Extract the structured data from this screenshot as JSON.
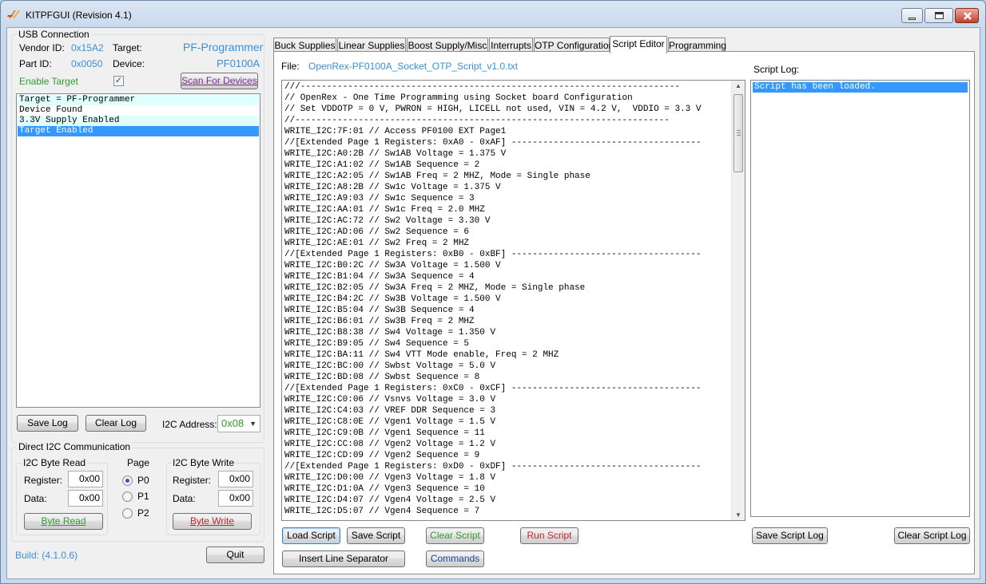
{
  "window": {
    "title": "KITPFGUI (Revision 4.1)"
  },
  "usb": {
    "group_title": "USB Connection",
    "vendor_label": "Vendor ID:",
    "vendor_value": "0x15A2",
    "target_label": "Target:",
    "target_value": "PF-Programmer",
    "part_label": "Part ID:",
    "part_value": "0x0050",
    "device_label": "Device:",
    "device_value": "PF0100A",
    "enable_target_label": "Enable Target",
    "enable_target_checked": true,
    "scan_button": "Scan For Devices"
  },
  "status_list": [
    "Target = PF-Programmer",
    "Device Found",
    "3.3V Supply Enabled",
    "Target Enabled"
  ],
  "log_buttons": {
    "save_log": "Save Log",
    "clear_log": "Clear Log"
  },
  "i2c_address": {
    "label": "I2C Address:",
    "value": "0x08"
  },
  "direct_i2c": {
    "group_title": "Direct I2C Communication",
    "read": {
      "title": "I2C Byte Read",
      "register_label": "Register:",
      "register_value": "0x00",
      "data_label": "Data:",
      "data_value": "0x00",
      "button": "Byte Read"
    },
    "page": {
      "title": "Page",
      "options": [
        "P0",
        "P1",
        "P2"
      ],
      "selected": "P0"
    },
    "write": {
      "title": "I2C Byte Write",
      "register_label": "Register:",
      "register_value": "0x00",
      "data_label": "Data:",
      "data_value": "0x00",
      "button": "Byte Write"
    }
  },
  "build": "Build: (4.1.0.6)",
  "quit_button": "Quit",
  "tabs": [
    "Buck Supplies",
    "Linear Supplies",
    "Boost Supply/Misc",
    "Interrupts",
    "OTP Configuration",
    "Script Editor",
    "Programming"
  ],
  "active_tab": "Script Editor",
  "script_editor": {
    "file_label": "File:",
    "file_name": "OpenRex-PF0100A_Socket_OTP_Script_v1.0.txt",
    "script_log_label": "Script Log:",
    "script_lines": [
      "///------------------------------------------------------------------------",
      "// OpenRex - One Time Programming using Socket board Configuration",
      "// Set VDDOTP = 0 V, PWRON = HIGH, LICELL not used, VIN = 4.2 V,  VDDIO = 3.3 V",
      "//-----------------------------------------------------------------------",
      "WRITE_I2C:7F:01 // Access PF0100 EXT Page1",
      "//[Extended Page 1 Registers: 0xA0 - 0xAF] ------------------------------------",
      "WRITE_I2C:A0:2B // Sw1AB Voltage = 1.375 V",
      "WRITE_I2C:A1:02 // Sw1AB Sequence = 2",
      "WRITE_I2C:A2:05 // Sw1AB Freq = 2 MHZ, Mode = Single phase",
      "WRITE_I2C:A8:2B // Sw1c Voltage = 1.375 V",
      "WRITE_I2C:A9:03 // Sw1c Sequence = 3",
      "WRITE_I2C:AA:01 // Sw1c Freq = 2.0 MHZ",
      "WRITE_I2C:AC:72 // Sw2 Voltage = 3.30 V",
      "WRITE_I2C:AD:06 // Sw2 Sequence = 6",
      "WRITE_I2C:AE:01 // Sw2 Freq = 2 MHZ",
      "//[Extended Page 1 Registers: 0xB0 - 0xBF] ------------------------------------",
      "WRITE_I2C:B0:2C // Sw3A Voltage = 1.500 V",
      "WRITE_I2C:B1:04 // Sw3A Sequence = 4",
      "WRITE_I2C:B2:05 // Sw3A Freq = 2 MHZ, Mode = Single phase",
      "WRITE_I2C:B4:2C // Sw3B Voltage = 1.500 V",
      "WRITE_I2C:B5:04 // Sw3B Sequence = 4",
      "WRITE_I2C:B6:01 // Sw3B Freq = 2 MHZ",
      "WRITE_I2C:B8:38 // Sw4 Voltage = 1.350 V",
      "WRITE_I2C:B9:05 // Sw4 Sequence = 5",
      "WRITE_I2C:BA:11 // Sw4 VTT Mode enable, Freq = 2 MHZ",
      "WRITE_I2C:BC:00 // Swbst Voltage = 5.0 V",
      "WRITE_I2C:BD:08 // Swbst Sequence = 8",
      "//[Extended Page 1 Registers: 0xC0 - 0xCF] ------------------------------------",
      "WRITE_I2C:C0:06 // Vsnvs Voltage = 3.0 V",
      "WRITE_I2C:C4:03 // VREF DDR Sequence = 3",
      "WRITE_I2C:C8:0E // Vgen1 Voltage = 1.5 V",
      "WRITE_I2C:C9:0B // Vgen1 Sequence = 11",
      "WRITE_I2C:CC:08 // Vgen2 Voltage = 1.2 V",
      "WRITE_I2C:CD:09 // Vgen2 Sequence = 9",
      "//[Extended Page 1 Registers: 0xD0 - 0xDF] ------------------------------------",
      "WRITE_I2C:D0:00 // Vgen3 Voltage = 1.8 V",
      "WRITE_I2C:D1:0A // Vgen3 Sequence = 10",
      "WRITE_I2C:D4:07 // Vgen4 Voltage = 2.5 V",
      "WRITE_I2C:D5:07 // Vgen4 Sequence = 7"
    ],
    "script_log_lines": [
      "Script has been loaded."
    ],
    "buttons": {
      "load_script": "Load Script",
      "save_script": "Save Script",
      "clear_script": "Clear Script",
      "run_script": "Run Script",
      "insert_line_separator": "Insert Line Separator",
      "commands": "Commands",
      "save_script_log": "Save Script Log",
      "clear_script_log": "Clear Script Log"
    }
  },
  "colors": {
    "label_blue": "#3a8fd6",
    "green": "#2e9c2e",
    "run_red": "#c0272d",
    "purple": "#7a2f8f",
    "selection": "#3399ff"
  }
}
